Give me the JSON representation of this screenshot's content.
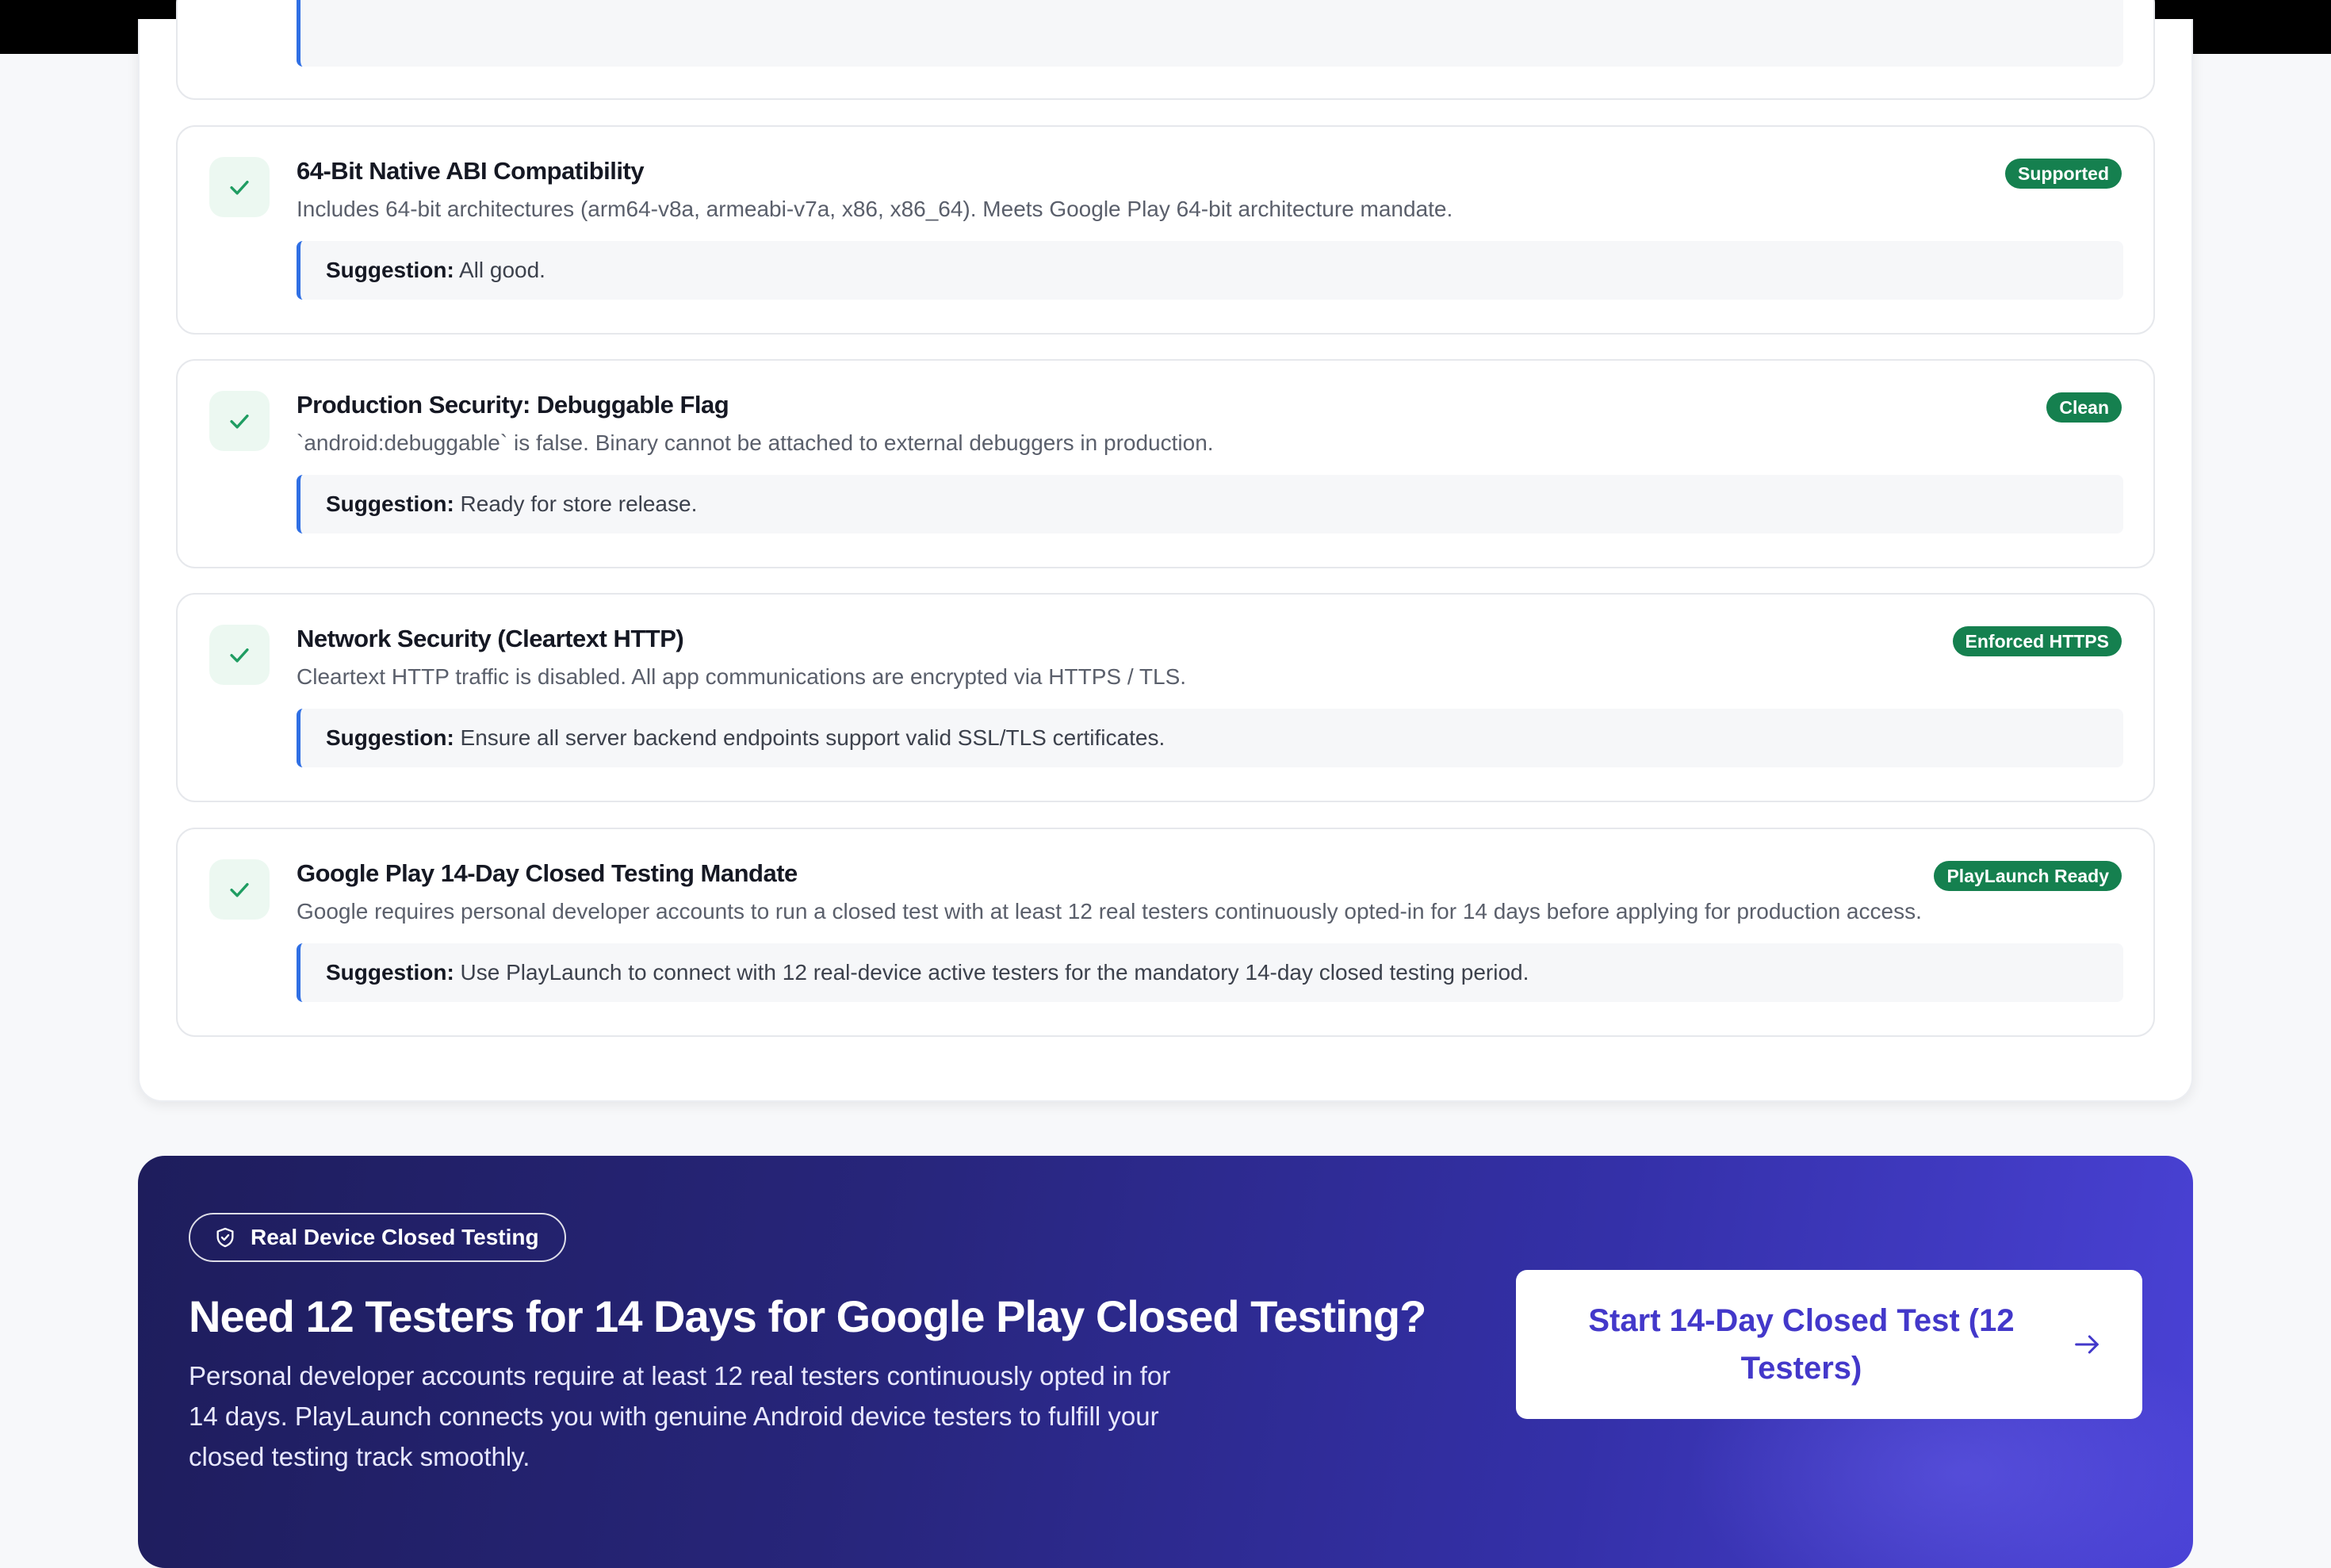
{
  "checks": [
    {
      "title": "64-Bit Native ABI Compatibility",
      "description": "Includes 64-bit architectures (arm64-v8a, armeabi-v7a, x86, x86_64). Meets Google Play 64-bit architecture mandate.",
      "badge": "Supported",
      "suggestion_label": "Suggestion:",
      "suggestion": "All good."
    },
    {
      "title": "Production Security: Debuggable Flag",
      "description": "`android:debuggable` is false. Binary cannot be attached to external debuggers in production.",
      "badge": "Clean",
      "suggestion_label": "Suggestion:",
      "suggestion": "Ready for store release."
    },
    {
      "title": "Network Security (Cleartext HTTP)",
      "description": "Cleartext HTTP traffic is disabled. All app communications are encrypted via HTTPS / TLS.",
      "badge": "Enforced HTTPS",
      "suggestion_label": "Suggestion:",
      "suggestion": "Ensure all server backend endpoints support valid SSL/TLS certificates."
    },
    {
      "title": "Google Play 14-Day Closed Testing Mandate",
      "description": "Google requires personal developer accounts to run a closed test with at least 12 real testers continuously opted-in for 14 days before applying for production access.",
      "badge": "PlayLaunch Ready",
      "suggestion_label": "Suggestion:",
      "suggestion": "Use PlayLaunch to connect with 12 real-device active testers for the mandatory 14-day closed testing period."
    }
  ],
  "cta": {
    "pill_label": "Real Device Closed Testing",
    "heading": "Need 12 Testers for 14 Days for Google Play Closed Testing?",
    "body": "Personal developer accounts require at least 12 real testers continuously opted in for 14 days. PlayLaunch connects you with genuine Android device testers to fulfill your closed testing track smoothly.",
    "button_label": "Start 14-Day Closed Test (12 Testers)"
  },
  "colors": {
    "badge_green": "#15804f",
    "check_green": "#1f9d62",
    "suggestion_accent": "#2f6fe4",
    "cta_button_text": "#4338ca"
  },
  "icons": {
    "check": "check-icon",
    "shield": "shield-check-icon",
    "arrow": "arrow-right-icon"
  }
}
